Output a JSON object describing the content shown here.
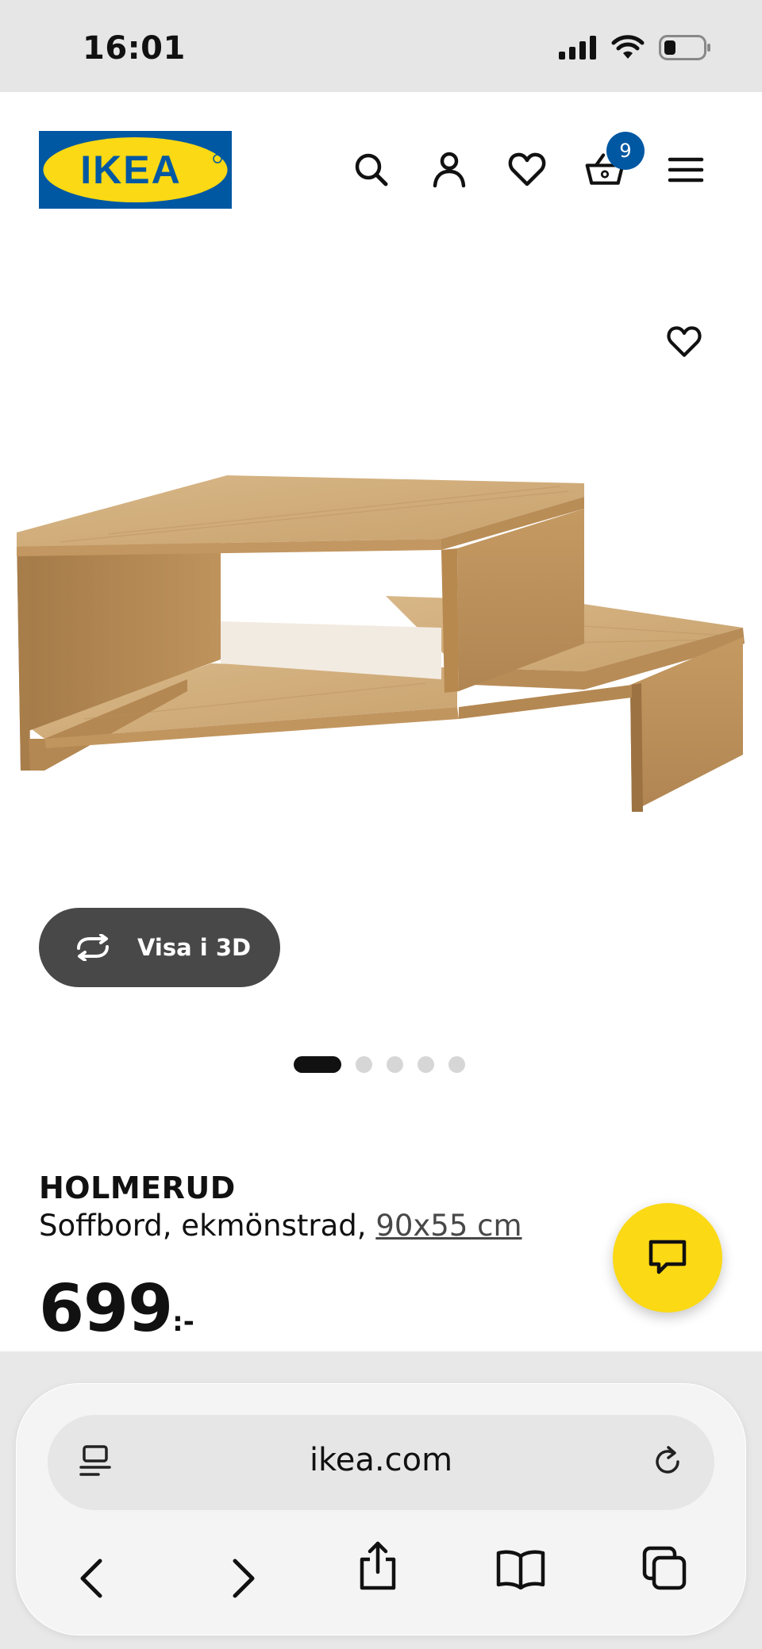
{
  "status_bar": {
    "time": "16:01"
  },
  "header": {
    "logo_text": "IKEA",
    "cart_count": "9",
    "icons": [
      "search-icon",
      "account-icon",
      "heart-icon",
      "cart-icon",
      "menu-icon"
    ]
  },
  "gallery": {
    "view_3d_label": "Visa i 3D",
    "image_count": 5,
    "active_index": 0
  },
  "product": {
    "name": "HOLMERUD",
    "description": "Soffbord, ekmönstrad,",
    "size": "90x55 cm",
    "price": "699",
    "price_suffix": ":-"
  },
  "browser": {
    "url": "ikea.com"
  },
  "colors": {
    "ikea_blue": "#0058a3",
    "ikea_yellow": "#fbd914",
    "dark_button": "#484848"
  }
}
